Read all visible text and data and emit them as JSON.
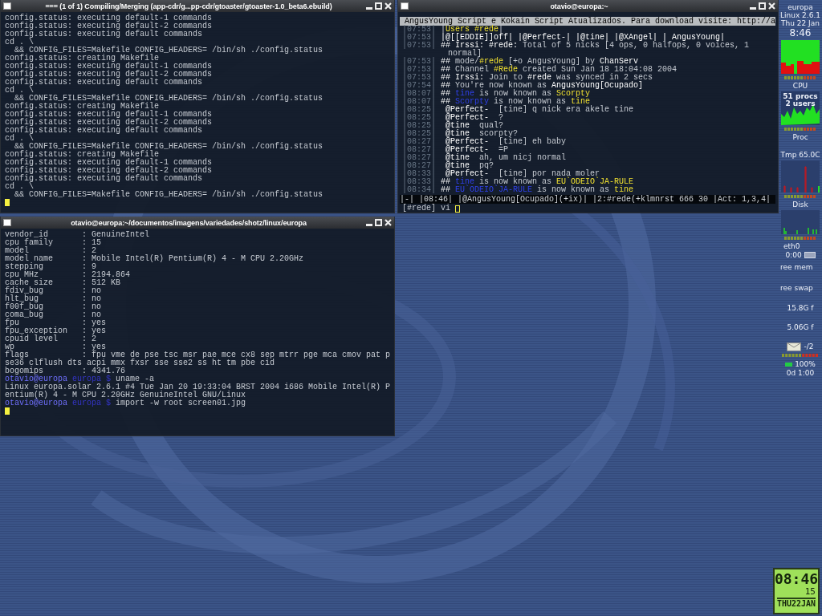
{
  "windows": [
    {
      "kind": "terminal",
      "title": "=== (1 of 1) Compiling/Merging (app-cdr/g...pp-cdr/gtoaster/gtoaster-1.0_beta6.ebuild)",
      "cursor": true,
      "lines": [
        {
          "text": "config.status: executing default-1 commands"
        },
        {
          "text": "config.status: executing default-2 commands"
        },
        {
          "text": "config.status: executing default commands"
        },
        {
          "text": "cd . \\"
        },
        {
          "text": "  && CONFIG_FILES=Makefile CONFIG_HEADERS= /bin/sh ./config.status"
        },
        {
          "text": "config.status: creating Makefile"
        },
        {
          "text": "config.status: executing default-1 commands"
        },
        {
          "text": "config.status: executing default-2 commands"
        },
        {
          "text": "config.status: executing default commands"
        },
        {
          "text": "cd . \\"
        },
        {
          "text": "  && CONFIG_FILES=Makefile CONFIG_HEADERS= /bin/sh ./config.status"
        },
        {
          "text": "config.status: creating Makefile"
        },
        {
          "text": "config.status: executing default-1 commands"
        },
        {
          "text": "config.status: executing default-2 commands"
        },
        {
          "text": "config.status: executing default commands"
        },
        {
          "text": "cd . \\"
        },
        {
          "text": "  && CONFIG_FILES=Makefile CONFIG_HEADERS= /bin/sh ./config.status"
        },
        {
          "text": "config.status: creating Makefile"
        },
        {
          "text": "config.status: executing default-1 commands"
        },
        {
          "text": "config.status: executing default-2 commands"
        },
        {
          "text": "config.status: executing default commands"
        },
        {
          "text": "cd . \\"
        },
        {
          "text": "  && CONFIG_FILES=Makefile CONFIG_HEADERS= /bin/sh ./config.status"
        }
      ]
    },
    {
      "kind": "irssi",
      "title": "otavio@europa:~",
      "cursor": true,
      "topic": " AngusYoung Script e Kokain Script Atualizados. Para download visite: http://a",
      "lines": [
        {
          "time": "|07:53|",
          "segments": [
            {
              "text": " |"
            },
            {
              "text": "Users #rede",
              "kind": "highlight"
            },
            {
              "text": "|"
            }
          ]
        },
        {
          "time": "|07:53|",
          "segments": [
            {
              "text": " |@[[EDDIE]]off| |@Perfect-| |@tine| |@XAngel| | AngusYoung|",
              "kind": "emphasis"
            }
          ]
        },
        {
          "time": "|07:53|",
          "segments": [
            {
              "text": " ## Irssi: #rede:",
              "kind": "emphasis"
            },
            {
              "text": " Total of 5 nicks [4 ops, 0 halfops, 0 voices, 1"
            }
          ]
        },
        {
          "segments": [
            {
              "text": "normal]"
            }
          ]
        },
        {
          "time": "|07:53|",
          "segments": [
            {
              "text": " ##",
              "kind": "emphasis"
            },
            {
              "text": " mode/"
            },
            {
              "text": "#rede",
              "kind": "highlight"
            },
            {
              "text": " [+o AngusYoung] by "
            },
            {
              "text": "ChanServ",
              "kind": "emphasis"
            }
          ]
        },
        {
          "time": "|07:53|",
          "segments": [
            {
              "text": " ##",
              "kind": "emphasis"
            },
            {
              "text": " Channel "
            },
            {
              "text": "#Rede",
              "kind": "highlight"
            },
            {
              "text": " created Sun Jan 18 18:04:08 2004"
            }
          ]
        },
        {
          "time": "|07:53|",
          "segments": [
            {
              "text": " ## Irssi:",
              "kind": "emphasis"
            },
            {
              "text": " Join to "
            },
            {
              "text": "#rede",
              "kind": "emphasis"
            },
            {
              "text": " was synced in 2 secs"
            }
          ]
        },
        {
          "time": "|07:54|",
          "segments": [
            {
              "text": " ##",
              "kind": "emphasis"
            },
            {
              "text": " You're now known as "
            },
            {
              "text": "AngusYoung[Ocupado]",
              "kind": "emphasis"
            }
          ]
        },
        {
          "time": "|08:07|",
          "segments": [
            {
              "text": " ##",
              "kind": "emphasis"
            },
            {
              "text": " tine",
              "kind": "old-nick"
            },
            {
              "text": " is now known as "
            },
            {
              "text": "Scorpty",
              "kind": "highlight"
            }
          ]
        },
        {
          "time": "|08:07|",
          "segments": [
            {
              "text": " ##",
              "kind": "emphasis"
            },
            {
              "text": " Scorpty",
              "kind": "old-nick"
            },
            {
              "text": " is now known as "
            },
            {
              "text": "tine",
              "kind": "highlight"
            }
          ]
        },
        {
          "time": "|08:25|",
          "segments": [
            {
              "text": "  @Perfect-",
              "kind": "emphasis"
            },
            {
              "text": "  [tine] q nick era akele tine"
            }
          ]
        },
        {
          "time": "|08:25|",
          "segments": [
            {
              "text": "  @Perfect-",
              "kind": "emphasis"
            },
            {
              "text": "  ?"
            }
          ]
        },
        {
          "time": "|08:25|",
          "segments": [
            {
              "text": "  @tine",
              "kind": "emphasis"
            },
            {
              "text": "  qual?"
            }
          ]
        },
        {
          "time": "|08:25|",
          "segments": [
            {
              "text": "  @tine",
              "kind": "emphasis"
            },
            {
              "text": "  scorpty?"
            }
          ]
        },
        {
          "time": "|08:27|",
          "segments": [
            {
              "text": "  @Perfect-",
              "kind": "emphasis"
            },
            {
              "text": "  [tine] eh baby"
            }
          ]
        },
        {
          "time": "|08:27|",
          "segments": [
            {
              "text": "  @Perfect-",
              "kind": "emphasis"
            },
            {
              "text": "  =P"
            }
          ]
        },
        {
          "time": "|08:27|",
          "segments": [
            {
              "text": "  @tine",
              "kind": "emphasis"
            },
            {
              "text": "  ah, um nicj normal"
            }
          ]
        },
        {
          "time": "|08:27|",
          "segments": [
            {
              "text": "  @tine",
              "kind": "emphasis"
            },
            {
              "text": "  pq?"
            }
          ]
        },
        {
          "time": "|08:33|",
          "segments": [
            {
              "text": "  @Perfect-",
              "kind": "emphasis"
            },
            {
              "text": "  [tine] por nada moler"
            }
          ]
        },
        {
          "time": "|08:33|",
          "segments": [
            {
              "text": " ##",
              "kind": "emphasis"
            },
            {
              "text": " tine",
              "kind": "old-nick"
            },
            {
              "text": " is now known as "
            },
            {
              "text": "EU`ODEIO`JA-RULE",
              "kind": "highlight"
            }
          ]
        },
        {
          "time": "|08:34|",
          "segments": [
            {
              "text": " ##",
              "kind": "emphasis"
            },
            {
              "text": " EU`ODEIO`JA-RULE",
              "kind": "old-nick"
            },
            {
              "text": " is now known as "
            },
            {
              "text": "tine",
              "kind": "highlight"
            }
          ]
        }
      ],
      "status_bar": "|-| |08:46| |@AngusYoung[Ocupado](+ix)| |2:#rede(+klmnrst 666 30 |Act: 1,3,4|",
      "input": "[#rede] vi"
    },
    {
      "kind": "terminal",
      "title": "otavio@europa:~/documentos/imagens/variedades/shotz/linux/europa",
      "cursor": true,
      "lines": [
        {
          "text": "vendor_id       : GenuineIntel"
        },
        {
          "text": "cpu family      : 15"
        },
        {
          "text": "model           : 2"
        },
        {
          "text": "model name      : Mobile Intel(R) Pentium(R) 4 - M CPU 2.20GHz"
        },
        {
          "text": "stepping        : 9"
        },
        {
          "text": "cpu MHz         : 2194.864"
        },
        {
          "text": "cache size      : 512 KB"
        },
        {
          "text": "fdiv_bug        : no"
        },
        {
          "text": "hlt_bug         : no"
        },
        {
          "text": "f00f_bug        : no"
        },
        {
          "text": "coma_bug        : no"
        },
        {
          "text": "fpu             : yes"
        },
        {
          "text": "fpu_exception   : yes"
        },
        {
          "text": "cpuid level     : 2"
        },
        {
          "text": "wp              : yes"
        },
        {
          "text": "flags           : fpu vme de pse tsc msr pae mce cx8 sep mtrr pge mca cmov pat p"
        },
        {
          "text": "se36 clflush dts acpi mmx fxsr sse sse2 ss ht tm pbe cid"
        },
        {
          "text": "bogomips        : 4341.76"
        },
        {
          "segments": [
            {
              "text": "otavio@europa",
              "kind": "prompt-user"
            },
            {
              "text": " europa $",
              "kind": "prompt-path"
            },
            {
              "text": " uname -a"
            }
          ]
        },
        {
          "text": "Linux europa.solar 2.6.1 #4 Tue Jan 20 19:33:04 BRST 2004 i686 Mobile Intel(R) P"
        },
        {
          "text": "entium(R) 4 - M CPU 2.20GHz GenuineIntel GNU/Linux"
        },
        {
          "segments": [
            {
              "text": "otavio@europa",
              "kind": "prompt-user"
            },
            {
              "text": " europa $",
              "kind": "prompt-path"
            },
            {
              "text": " import -w root screen01.jpg"
            }
          ]
        }
      ]
    }
  ],
  "monitor": {
    "host": "europa",
    "kernel": "Linux 2.6.1",
    "date": "Thu 22 Jan",
    "time": "8:46",
    "cpu_label": "CPU",
    "procs": "51 procs",
    "users": "2 users",
    "proc_label": "Proc",
    "temperature": "Tmp 65.0C",
    "disk_label": "Disk",
    "net_label": "eth0",
    "net_time": "0:00",
    "mem_label": "ree mem",
    "swap_label": "ree swap",
    "fs1": "15.8G f",
    "fs2": "5.06G f",
    "mail": "-/2",
    "battery": "100%",
    "uptime": "0d 1:00"
  },
  "clock": {
    "time": "08:46",
    "seconds": "15",
    "date": "THU22JAN"
  }
}
